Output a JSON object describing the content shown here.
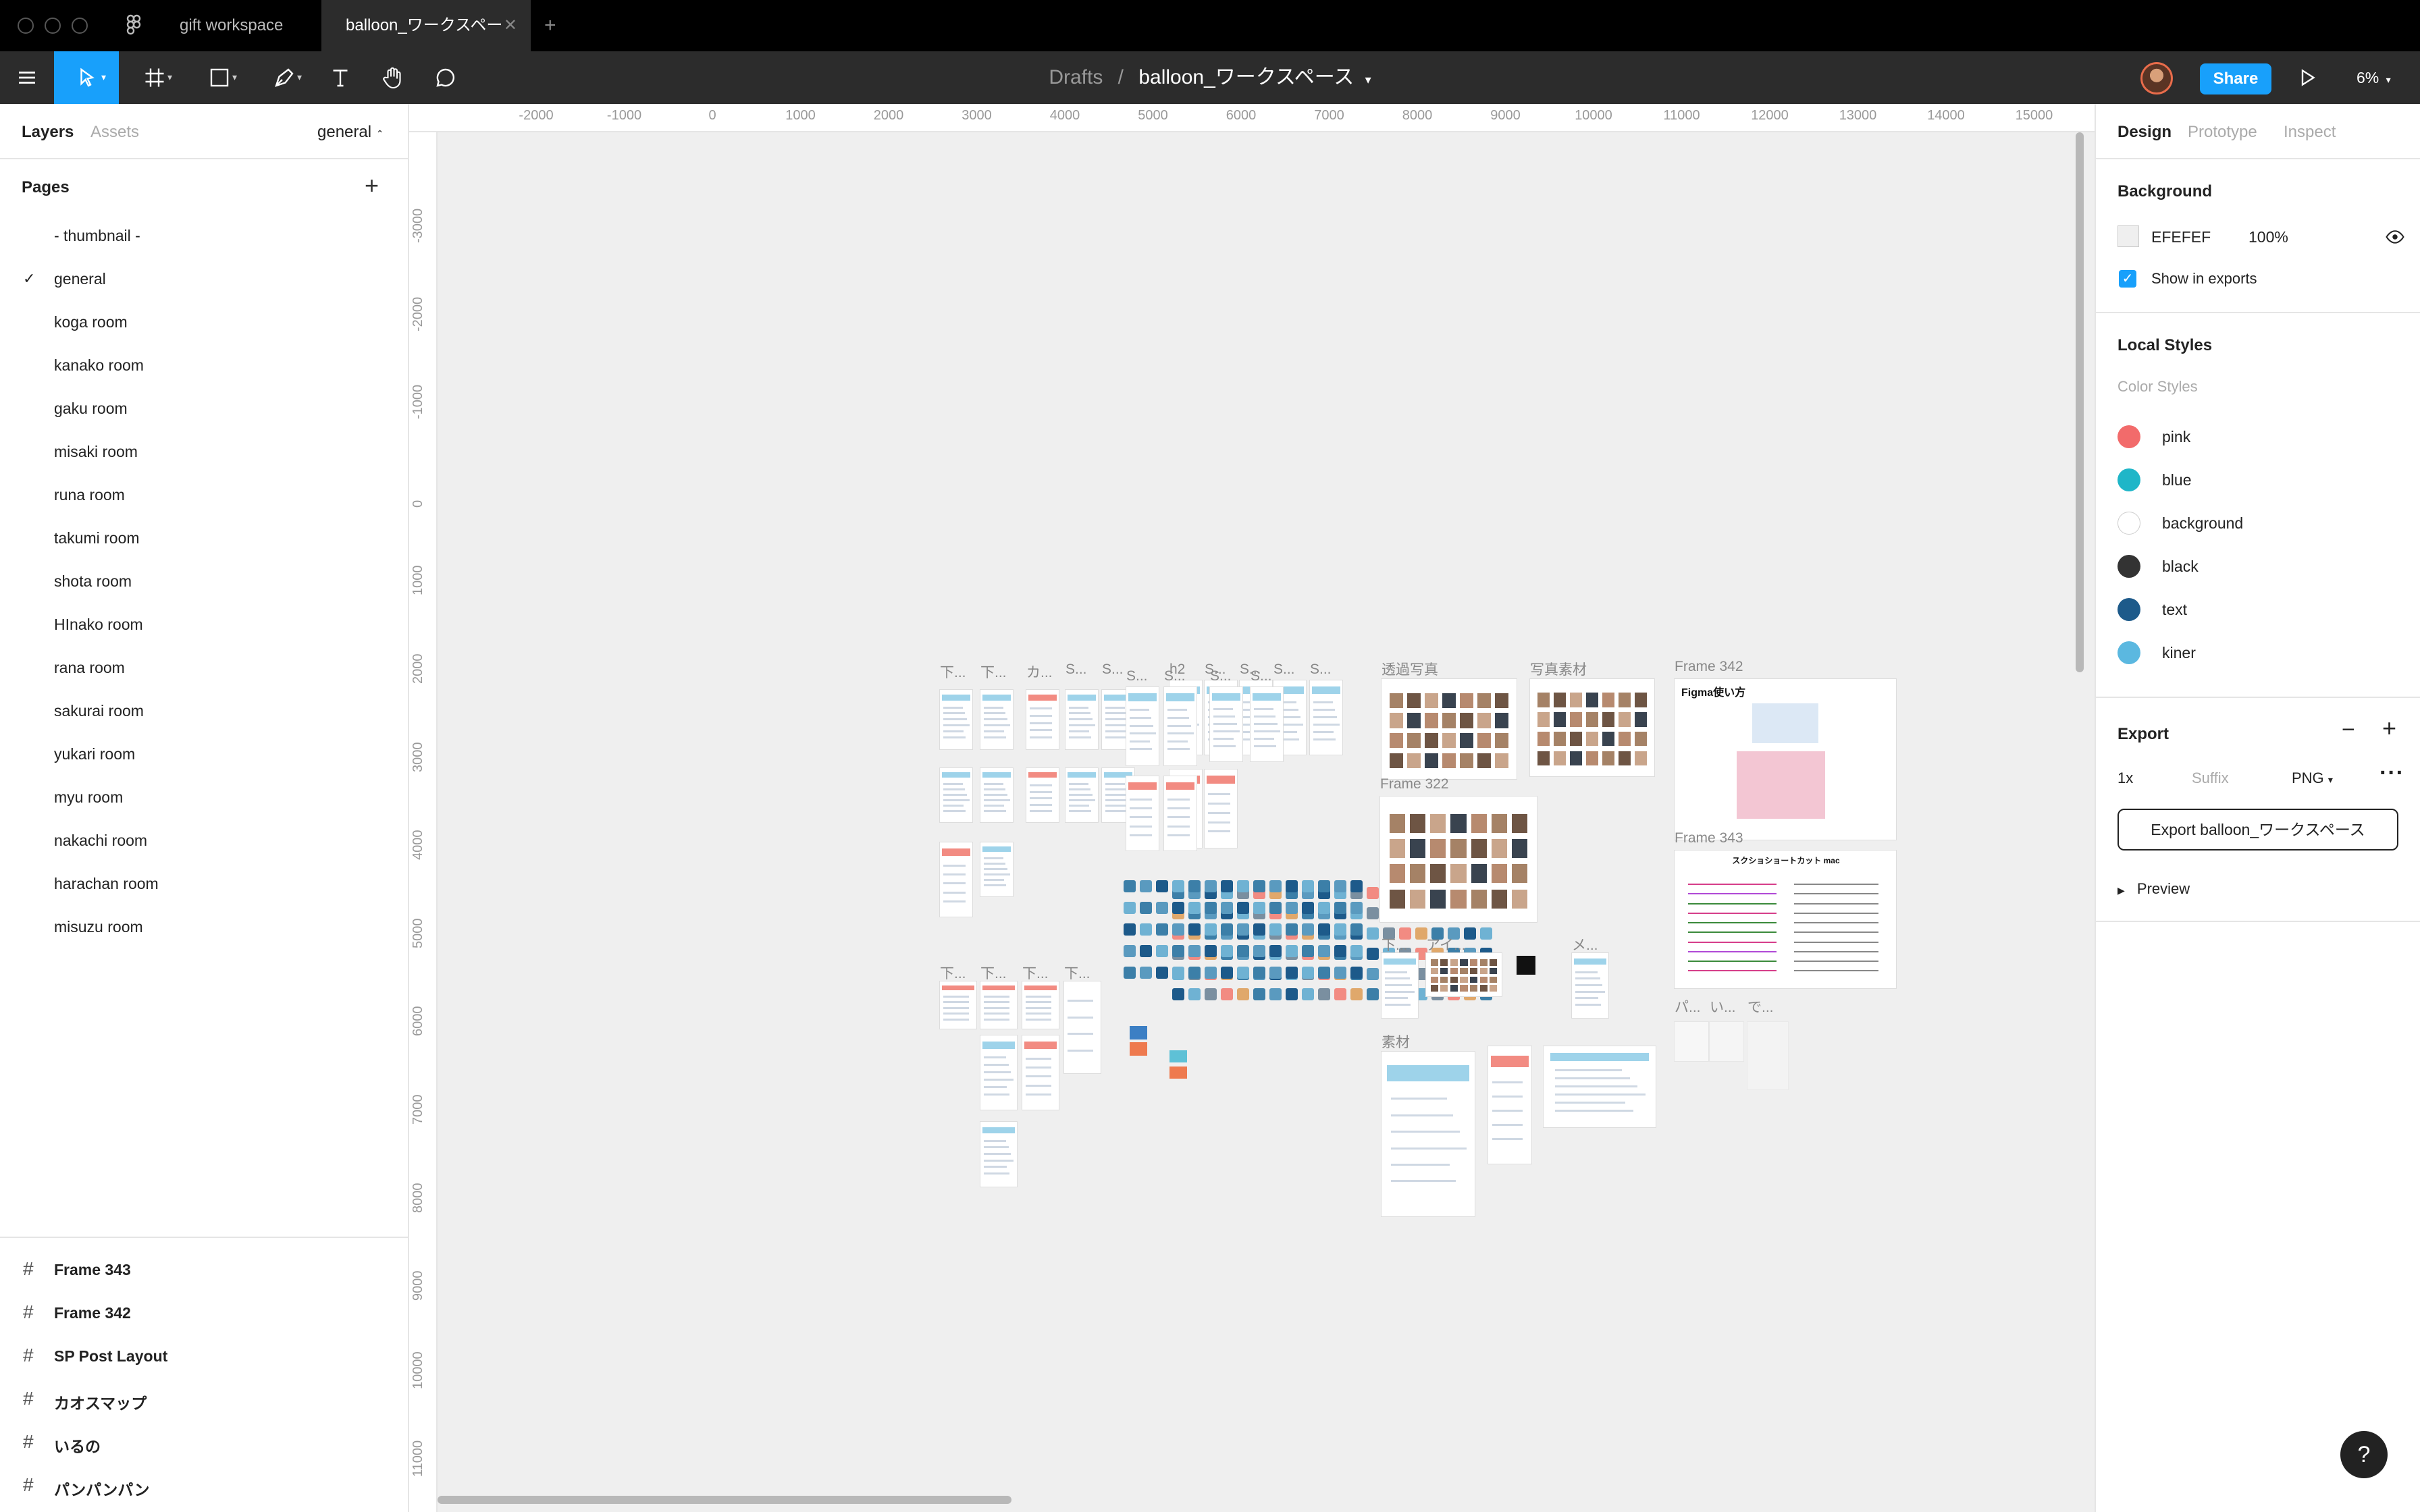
{
  "titlebar": {
    "tabs": [
      {
        "label": "gift workspace"
      },
      {
        "label": "balloon_ワークスペース"
      }
    ]
  },
  "toolbar": {
    "breadcrumb_root": "Drafts",
    "breadcrumb_sep": "/",
    "file_name": "balloon_ワークスペース",
    "share_label": "Share",
    "zoom": "6%",
    "icons": [
      "menu-icon",
      "move-icon",
      "frame-icon",
      "rectangle-icon",
      "pen-icon",
      "text-icon",
      "hand-icon",
      "comment-icon",
      "play-icon"
    ]
  },
  "left_panel": {
    "tabs": [
      "Layers",
      "Assets"
    ],
    "current_page": "general",
    "pages_title": "Pages",
    "add_symbol": "+",
    "pages": [
      "- thumbnail -",
      "general",
      "koga room",
      "kanako room",
      "gaku room",
      "misaki room",
      "runa room",
      "takumi room",
      "shota room",
      "HInako room",
      "rana room",
      "sakurai room",
      "yukari room",
      "myu room",
      "nakachi room",
      "harachan room",
      "misuzu room"
    ],
    "selected_page_index": 1,
    "layers": [
      "Frame 343",
      "Frame 342",
      "SP Post Layout",
      "カオスマップ",
      "いるの",
      "パンパンパン"
    ]
  },
  "canvas": {
    "hruler": [
      "-2000",
      "-1000",
      "0",
      "1000",
      "2000",
      "3000",
      "4000",
      "5000",
      "6000",
      "7000",
      "8000",
      "9000",
      "10000",
      "11000",
      "12000",
      "13000",
      "14000",
      "15000"
    ],
    "vruler": [
      "-3000",
      "-2000",
      "-1000",
      "0",
      "1000",
      "2000",
      "3000",
      "4000",
      "5000",
      "6000",
      "7000",
      "8000",
      "9000",
      "10000",
      "11000",
      "12000"
    ],
    "frame_labels": {
      "a1": "下...",
      "a2": "下...",
      "a3": "カ...",
      "a4": "S...",
      "a5": "S...",
      "b1": "h2",
      "b2": "S...",
      "b3": "S...",
      "b4": "S...",
      "b5": "S...",
      "c1": "S...",
      "c2": "S...",
      "c3": "S...",
      "c4": "S...",
      "d1": "透過写真",
      "d2": "写真素材",
      "d3": "Frame 342",
      "e1": "Frame 322",
      "e2": "Frame 343",
      "f1": "下...",
      "f2": "アイ...",
      "f3": "メ...",
      "g1": "素材",
      "h1": "下...",
      "h2": "下...",
      "h3": "下...",
      "h4": "下...",
      "i1": "パ...",
      "i2": "い...",
      "i3": "で..."
    },
    "frame_text": {
      "figma_title": "Figma使い方",
      "shortcut_title": "スクショショートカット mac"
    }
  },
  "right_panel": {
    "tabs": [
      "Design",
      "Prototype",
      "Inspect"
    ],
    "background_title": "Background",
    "background_hex": "EFEFEF",
    "background_opacity": "100%",
    "show_in_exports": "Show in exports",
    "local_styles_title": "Local Styles",
    "color_styles_title": "Color Styles",
    "color_styles": [
      {
        "name": "pink",
        "color": "#f26b6b"
      },
      {
        "name": "blue",
        "color": "#1fb6c8"
      },
      {
        "name": "background",
        "color": "#ffffff"
      },
      {
        "name": "black",
        "color": "#333333"
      },
      {
        "name": "text",
        "color": "#1d5a8a"
      },
      {
        "name": "kiner",
        "color": "#5bb8e0"
      }
    ],
    "export_title": "Export",
    "export_scale": "1x",
    "export_suffix_placeholder": "Suffix",
    "export_format": "PNG",
    "export_button": "Export balloon_ワークスペース",
    "preview_label": "Preview"
  },
  "help_label": "?"
}
